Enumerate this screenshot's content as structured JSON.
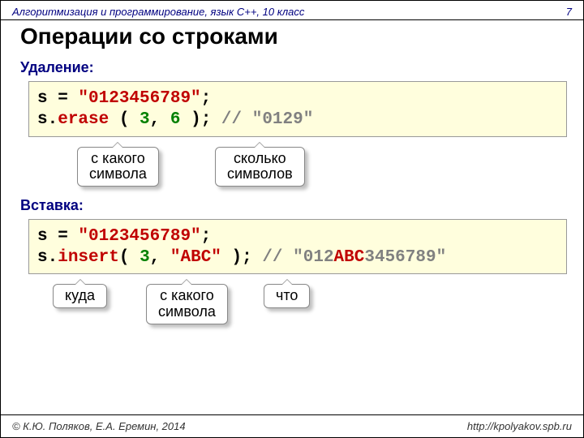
{
  "header": {
    "course": "Алгоритмизация и программирование, язык C++, 10 класс",
    "page": "7"
  },
  "title": "Операции со строками",
  "sections": {
    "delete": {
      "label": "Удаление:",
      "code_l1_a": "s = ",
      "code_l1_b": "\"0123456789\"",
      "code_l1_c": ";",
      "code_l2_a": "s.",
      "code_l2_fn": "erase",
      "code_l2_b": " ( ",
      "code_l2_n1": "3",
      "code_l2_c": ", ",
      "code_l2_n2": "6",
      "code_l2_d": " ); ",
      "code_l2_cmt": "// \"0129\"",
      "callout1": "с какого\nсимвола",
      "callout2": "сколько\nсимволов"
    },
    "insert": {
      "label": "Вставка:",
      "code_l1_a": "s = ",
      "code_l1_b": "\"0123456789\"",
      "code_l1_c": ";",
      "code_l2_a": "s.",
      "code_l2_fn": "insert",
      "code_l2_b": "( ",
      "code_l2_n1": "3",
      "code_l2_c": ", ",
      "code_l2_s": "\"ABC\"",
      "code_l2_d": " ); ",
      "code_l2_cmt_a": "// \"012",
      "code_l2_cmt_b": "ABC",
      "code_l2_cmt_c": "3456789\"",
      "callout1": "куда",
      "callout2": "с какого\nсимвола",
      "callout3": "что"
    }
  },
  "footer": {
    "left": "© К.Ю. Поляков, Е.А. Еремин, 2014",
    "right": "http://kpolyakov.spb.ru"
  }
}
